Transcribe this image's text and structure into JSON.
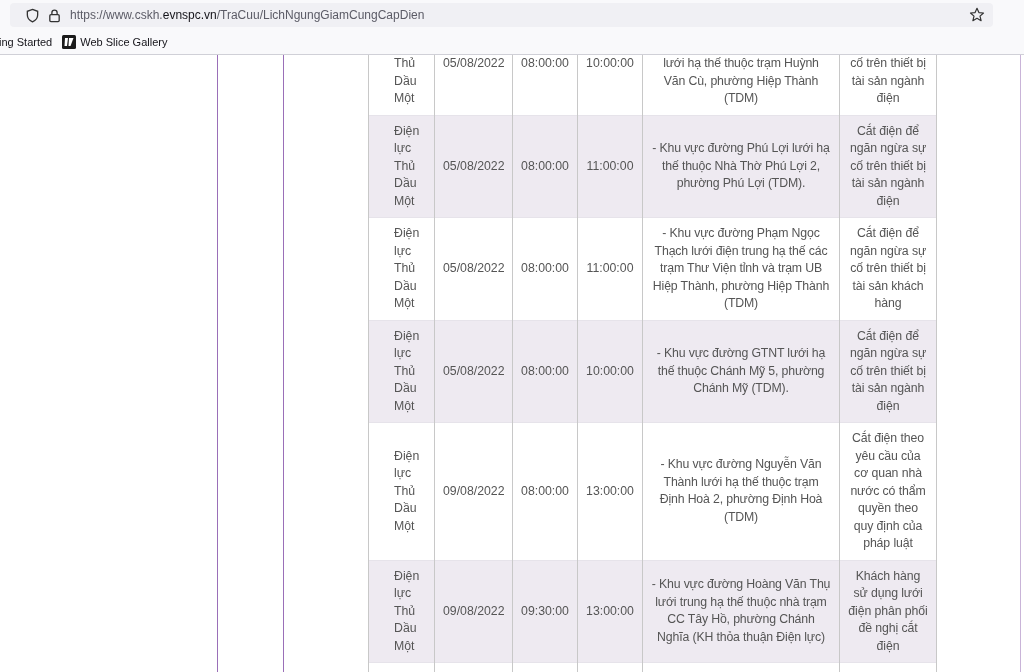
{
  "address_bar": {
    "url_prefix": "https://www.cskh.",
    "url_domain": "evnspc.vn",
    "url_path": "/TraCuu/LichNgungGiamCungCapDien"
  },
  "bookmarks": [
    {
      "label": "ing Started",
      "kind": "plain"
    },
    {
      "label": "Web Slice Gallery",
      "kind": "slice"
    }
  ],
  "table": {
    "rows": [
      {
        "kind": "cut_top",
        "unit": "Thủ Dầu Một",
        "date": "05/08/2022",
        "start": "08:00:00",
        "end": "10:00:00",
        "area": "lưới hạ thế thuộc trạm Huỳnh Văn Cù, phường Hiệp Thành (TDM)",
        "reason": "cố trên thiết bị tài sản ngành điện"
      },
      {
        "kind": "full",
        "unit": "Điện lực Thủ Dầu Một",
        "date": "05/08/2022",
        "start": "08:00:00",
        "end": "11:00:00",
        "area": "- Khu vực đường Phú Lợi lưới hạ thế thuộc Nhà Thờ Phú Lợi 2, phường Phú Lợi (TDM).",
        "reason": "Cắt điện để ngăn ngừa sự cố trên thiết bị tài sản ngành điện"
      },
      {
        "kind": "full",
        "unit": "Điện lực Thủ Dầu Một",
        "date": "05/08/2022",
        "start": "08:00:00",
        "end": "11:00:00",
        "area": "- Khu vực đường Phạm Ngọc Thạch lưới điện trung hạ thế các trạm Thư Viện tỉnh và trạm UB Hiệp Thành, phường Hiệp Thành (TDM)",
        "reason": "Cắt điện để ngăn ngừa sự cố trên thiết bị tài sản khách hàng"
      },
      {
        "kind": "full",
        "unit": "Điện lực Thủ Dầu Một",
        "date": "05/08/2022",
        "start": "08:00:00",
        "end": "10:00:00",
        "area": "- Khu vực đường GTNT lưới hạ thế thuộc Chánh Mỹ 5, phường Chánh Mỹ (TDM).",
        "reason": "Cắt điện để ngăn ngừa sự cố trên thiết bị tài sản ngành điện"
      },
      {
        "kind": "full",
        "unit": "Điện lực Thủ Dầu Một",
        "date": "09/08/2022",
        "start": "08:00:00",
        "end": "13:00:00",
        "area": "- Khu vực đường Nguyễn Văn Thành lưới hạ thế thuộc trạm Định Hoà 2, phường Định Hoà (TDM)",
        "reason": "Cắt điện theo yêu cầu của cơ quan nhà nước có thẩm quyền theo quy định của pháp luật"
      },
      {
        "kind": "full",
        "unit": "Điện lực Thủ Dầu Một",
        "date": "09/08/2022",
        "start": "09:30:00",
        "end": "13:00:00",
        "area": "- Khu vực đường Hoàng Văn Thụ lưới trung hạ thế thuộc nhà trạm CC Tây Hồ, phường Chánh Nghĩa (KH thỏa thuận Điện lực)",
        "reason": "Khách hàng sử dụng lưới điện phân phối đề nghị cắt điện"
      }
    ]
  }
}
